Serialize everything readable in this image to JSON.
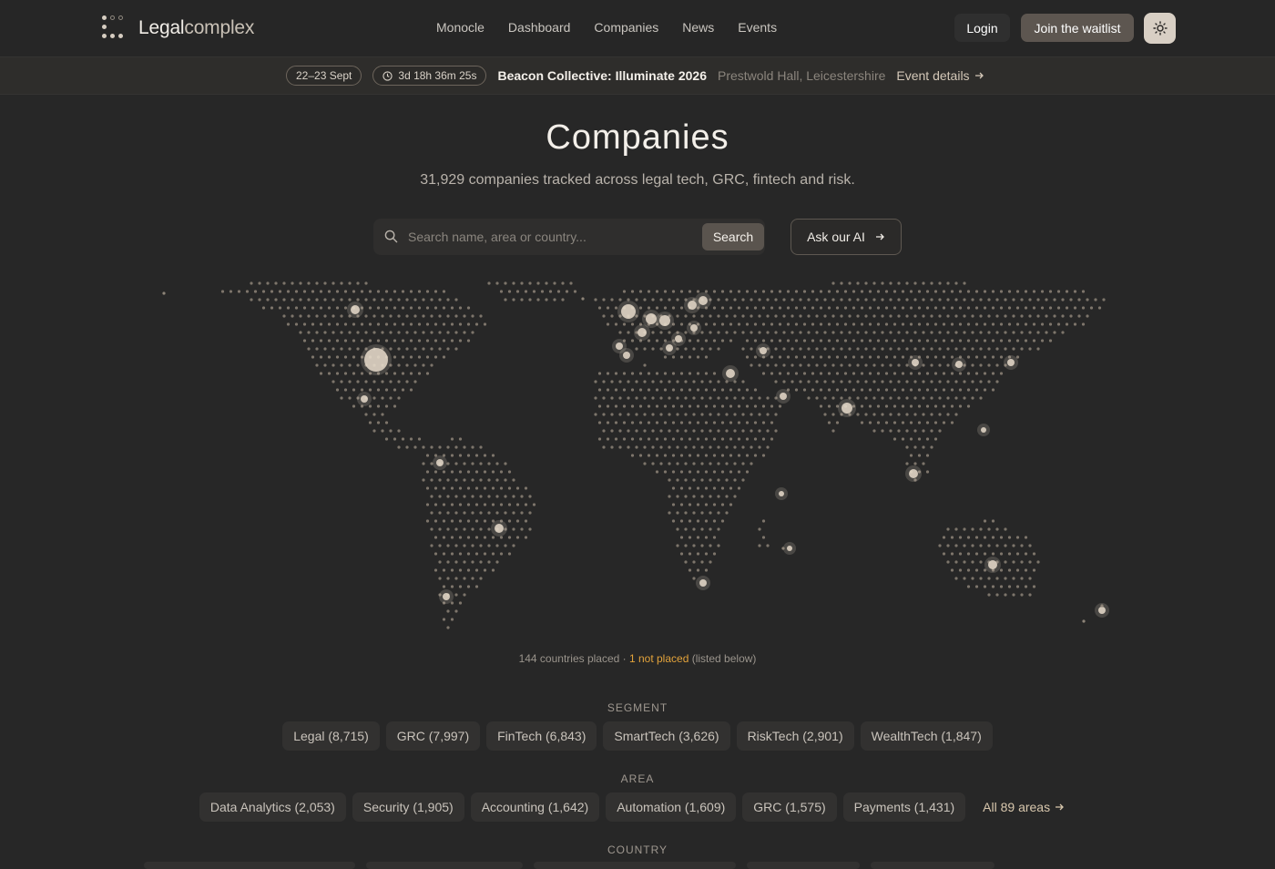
{
  "brand": {
    "name_main": "Legal",
    "name_light": "complex"
  },
  "nav": [
    "Monocle",
    "Dashboard",
    "Companies",
    "News",
    "Events"
  ],
  "header": {
    "login": "Login",
    "waitlist": "Join the waitlist",
    "theme_icon": "sun-icon"
  },
  "event": {
    "dates": "22–23 Sept",
    "countdown": "3d 18h 36m 25s",
    "title": "Beacon Collective: Illuminate 2026",
    "location": "Prestwold Hall, Leicestershire",
    "link": "Event details"
  },
  "page": {
    "title": "Companies",
    "subtitle": "31,929 companies tracked across legal tech, GRC, fintech and risk."
  },
  "search": {
    "placeholder": "Search name, area or country...",
    "button": "Search",
    "ai_button": "Ask our AI"
  },
  "map_caption": {
    "placed": "144 countries placed · ",
    "not_placed": "1 not placed",
    "tail": " (listed below)"
  },
  "segment": {
    "label": "SEGMENT",
    "items": [
      "Legal (8,715)",
      "GRC (7,997)",
      "FinTech (6,843)",
      "SmartTech (3,626)",
      "RiskTech (2,901)",
      "WealthTech (1,847)"
    ]
  },
  "area": {
    "label": "AREA",
    "items": [
      "Data Analytics (2,053)",
      "Security (1,905)",
      "Accounting (1,642)",
      "Automation (1,609)",
      "GRC (1,575)",
      "Payments (1,431)"
    ],
    "all_link": "All 89 areas"
  },
  "country": {
    "label": "COUNTRY"
  },
  "colors": {
    "background": "#272727",
    "accent": "#d8cfc4",
    "warning": "#e3a33b",
    "dot": "#8d8478",
    "highlight": "#e8dccb"
  }
}
